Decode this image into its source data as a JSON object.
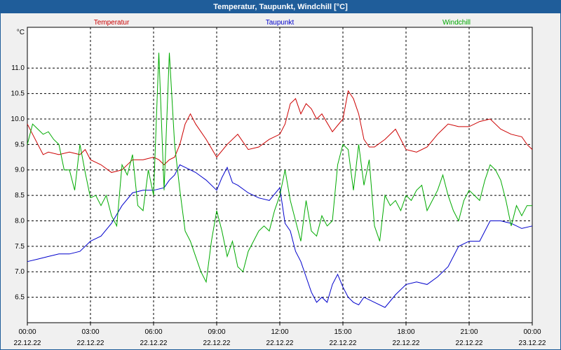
{
  "window": {
    "title": "Temperatur, Taupunkt, Windchill [°C]"
  },
  "chart_data": {
    "type": "line",
    "title": "Temperatur, Taupunkt, Windchill [°C]",
    "ylabel": "°C",
    "ylim": [
      6.0,
      11.8
    ],
    "xlim": [
      0,
      24
    ],
    "grid": true,
    "legend_position": "top",
    "y_ticks": [
      6.5,
      7.0,
      7.5,
      8.0,
      8.5,
      9.0,
      9.5,
      10.0,
      10.5,
      11.0
    ],
    "x_ticks": [
      {
        "x": 0,
        "time": "00:00",
        "date": "22.12.22"
      },
      {
        "x": 3,
        "time": "03:00",
        "date": "22.12.22"
      },
      {
        "x": 6,
        "time": "06:00",
        "date": "22.12.22"
      },
      {
        "x": 9,
        "time": "09:00",
        "date": "22.12.22"
      },
      {
        "x": 12,
        "time": "12:00",
        "date": "22.12.22"
      },
      {
        "x": 15,
        "time": "15:00",
        "date": "22.12.22"
      },
      {
        "x": 18,
        "time": "18:00",
        "date": "22.12.22"
      },
      {
        "x": 21,
        "time": "21:00",
        "date": "22.12.22"
      },
      {
        "x": 24,
        "time": "00:00",
        "date": "23.12.22"
      }
    ],
    "series": [
      {
        "name": "Temperatur",
        "color": "#cc0000",
        "x": [
          0,
          0.25,
          0.5,
          0.75,
          1,
          1.5,
          2,
          2.5,
          2.75,
          3,
          3.25,
          3.5,
          4,
          4.5,
          5,
          5.5,
          6,
          6.25,
          6.5,
          6.75,
          7,
          7.25,
          7.5,
          7.75,
          8,
          8.5,
          9,
          9.5,
          10,
          10.5,
          11,
          11.5,
          12,
          12.25,
          12.5,
          12.75,
          13,
          13.25,
          13.5,
          13.75,
          14,
          14.5,
          15,
          15.25,
          15.5,
          15.75,
          16,
          16.25,
          16.5,
          17,
          17.5,
          18,
          18.5,
          19,
          19.5,
          20,
          20.5,
          21,
          21.5,
          22,
          22.5,
          23,
          23.5,
          23.75,
          24
        ],
        "y": [
          9.9,
          9.7,
          9.5,
          9.3,
          9.35,
          9.3,
          9.35,
          9.3,
          9.4,
          9.2,
          9.15,
          9.1,
          8.95,
          9.0,
          9.2,
          9.2,
          9.25,
          9.2,
          9.1,
          9.2,
          9.25,
          9.5,
          9.9,
          10.1,
          9.9,
          9.6,
          9.25,
          9.5,
          9.7,
          9.4,
          9.45,
          9.6,
          9.7,
          9.9,
          10.3,
          10.4,
          10.1,
          10.3,
          10.2,
          10.0,
          10.1,
          9.75,
          10.0,
          10.55,
          10.4,
          10.1,
          9.6,
          9.45,
          9.45,
          9.6,
          9.8,
          9.4,
          9.35,
          9.45,
          9.7,
          9.9,
          9.85,
          9.85,
          9.95,
          10.0,
          9.8,
          9.7,
          9.65,
          9.5,
          9.4
        ]
      },
      {
        "name": "Taupunkt",
        "color": "#0000cc",
        "x": [
          0,
          0.5,
          1,
          1.5,
          2,
          2.5,
          3,
          3.5,
          4,
          4.5,
          5,
          5.5,
          6,
          6.5,
          6.75,
          7,
          7.25,
          7.5,
          7.75,
          8,
          8.5,
          9,
          9.25,
          9.5,
          9.75,
          10,
          10.5,
          11,
          11.5,
          12,
          12.25,
          12.5,
          12.75,
          13,
          13.25,
          13.5,
          13.75,
          14,
          14.25,
          14.5,
          14.75,
          15,
          15.25,
          15.5,
          15.75,
          16,
          16.5,
          17,
          17.5,
          18,
          18.5,
          19,
          19.5,
          20,
          20.5,
          21,
          21.5,
          22,
          22.5,
          23,
          23.5,
          24
        ],
        "y": [
          7.2,
          7.25,
          7.3,
          7.35,
          7.35,
          7.4,
          7.6,
          7.7,
          7.95,
          8.3,
          8.55,
          8.6,
          8.6,
          8.65,
          8.8,
          8.9,
          9.1,
          9.05,
          9.0,
          8.95,
          8.8,
          8.6,
          8.85,
          9.05,
          8.75,
          8.7,
          8.55,
          8.45,
          8.4,
          8.65,
          7.95,
          7.8,
          7.4,
          7.2,
          6.9,
          6.6,
          6.4,
          6.5,
          6.4,
          6.75,
          6.95,
          6.7,
          6.5,
          6.4,
          6.35,
          6.5,
          6.4,
          6.3,
          6.55,
          6.75,
          6.8,
          6.75,
          6.9,
          7.1,
          7.5,
          7.6,
          7.6,
          8.0,
          8.0,
          7.95,
          7.85,
          7.9
        ]
      },
      {
        "name": "Windchill",
        "color": "#00aa00",
        "x": [
          0,
          0.25,
          0.5,
          0.75,
          1,
          1.25,
          1.5,
          1.75,
          2,
          2.25,
          2.5,
          2.75,
          3,
          3.25,
          3.5,
          3.75,
          4,
          4.25,
          4.5,
          4.75,
          5,
          5.25,
          5.5,
          5.75,
          6,
          6.25,
          6.5,
          6.75,
          7,
          7.25,
          7.5,
          7.75,
          8,
          8.25,
          8.5,
          8.75,
          9,
          9.25,
          9.5,
          9.75,
          10,
          10.25,
          10.5,
          10.75,
          11,
          11.25,
          11.5,
          11.75,
          12,
          12.25,
          12.5,
          12.75,
          13,
          13.25,
          13.5,
          13.75,
          14,
          14.25,
          14.5,
          14.75,
          15,
          15.25,
          15.5,
          15.75,
          16,
          16.25,
          16.5,
          16.75,
          17,
          17.25,
          17.5,
          17.75,
          18,
          18.25,
          18.5,
          18.75,
          19,
          19.25,
          19.5,
          19.75,
          20,
          20.25,
          20.5,
          20.75,
          21,
          21.25,
          21.5,
          21.75,
          22,
          22.25,
          22.5,
          22.75,
          23,
          23.25,
          23.5,
          23.75,
          24
        ],
        "y": [
          9.5,
          9.9,
          9.8,
          9.7,
          9.75,
          9.6,
          9.5,
          9.0,
          9.0,
          8.6,
          9.5,
          8.95,
          8.45,
          8.5,
          8.3,
          8.5,
          8.1,
          7.9,
          9.1,
          8.9,
          9.3,
          8.3,
          8.2,
          9.0,
          8.5,
          11.3,
          8.6,
          11.3,
          9.5,
          8.6,
          7.8,
          7.6,
          7.3,
          7.0,
          6.8,
          7.6,
          8.2,
          7.8,
          7.3,
          7.6,
          7.1,
          7.0,
          7.4,
          7.6,
          7.8,
          7.9,
          7.8,
          8.2,
          8.5,
          9.0,
          8.4,
          8.0,
          7.6,
          8.4,
          7.8,
          7.7,
          8.1,
          7.9,
          8.0,
          9.1,
          9.5,
          9.4,
          8.6,
          9.5,
          8.7,
          9.2,
          7.9,
          7.6,
          8.5,
          8.3,
          8.4,
          8.2,
          8.5,
          8.4,
          8.6,
          8.7,
          8.2,
          8.4,
          8.6,
          8.9,
          8.5,
          8.2,
          8.0,
          8.4,
          8.6,
          8.5,
          8.4,
          8.8,
          9.1,
          9.0,
          8.8,
          8.4,
          7.9,
          8.3,
          8.1,
          8.3,
          8.3
        ]
      }
    ]
  }
}
